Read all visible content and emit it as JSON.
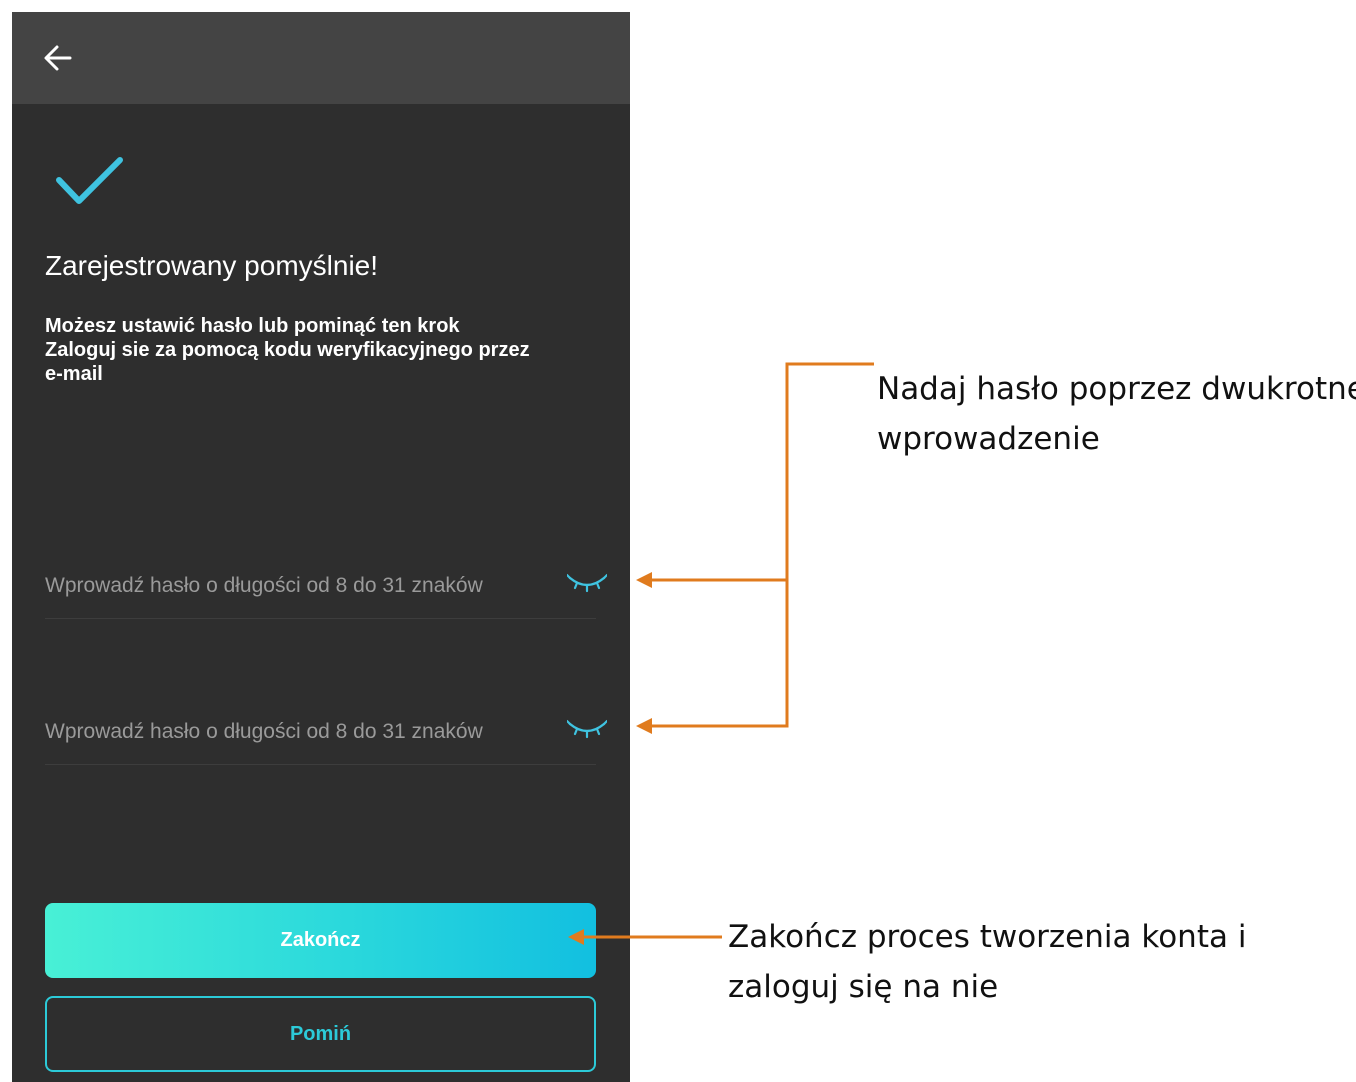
{
  "screen": {
    "title": "Zarejestrowany pomyślnie!",
    "subtitle_lines": [
      "Możesz ustawić hasło lub pominąć ten krok",
      "Zaloguj sie za pomocą kodu weryfikacyjnego przez",
      "e-mail"
    ],
    "password_field": {
      "placeholder": "Wprowadź hasło o długości od 8 do 31 znaków",
      "value": ""
    },
    "confirm_password_field": {
      "placeholder": "Wprowadź hasło o długości od 8 do 31 znaków",
      "value": ""
    },
    "finish_button": "Zakończ",
    "skip_button": "Pomiń"
  },
  "annotations": {
    "password_note_lines": [
      "Nadaj hasło poprzez dwukrotne",
      "wprowadzenie"
    ],
    "finish_note_lines": [
      "Zakończ proces tworzenia konta i",
      "zaloguj się na nie"
    ]
  },
  "colors": {
    "screen_background": "#2e2e2e",
    "top_bar": "#444444",
    "accent": "#2ccad8",
    "annotation_arrow": "#e07b1e"
  },
  "icons": {
    "back": "arrow-left-icon",
    "success": "checkmark-icon",
    "password_visibility": "eye-closed-icon"
  }
}
